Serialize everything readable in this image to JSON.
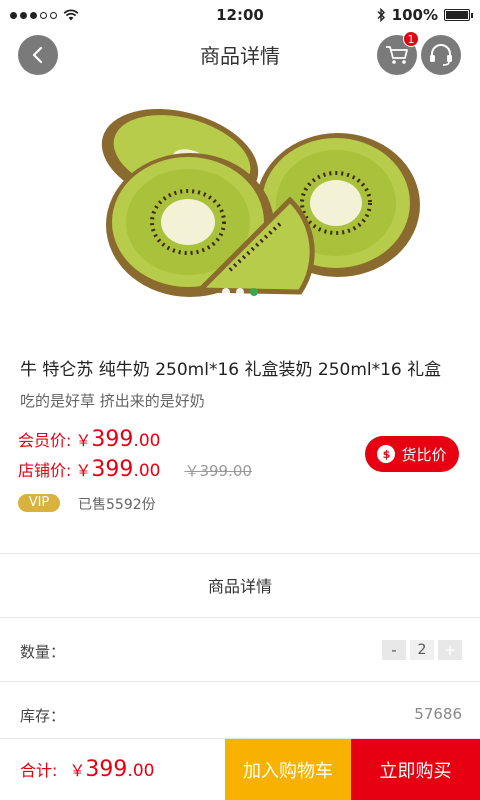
{
  "status_bar": {
    "time": "12:00",
    "battery": "100%"
  },
  "header": {
    "title": "商品详情",
    "cart_count": "1"
  },
  "product": {
    "name": "牛 特仑苏 纯牛奶 250ml*16 礼盒装奶 250ml*16 礼盒",
    "slogan": "吃的是好草 挤出来的是好奶",
    "member_price_label": "会员价:",
    "store_price_label": "店铺价:",
    "currency": "￥",
    "member_price_int": "399",
    "member_price_dec": ".00",
    "store_price_int": "399",
    "store_price_dec": ".00",
    "original_price": "￥399.00",
    "compare_label": "货比价",
    "compare_coin": "$",
    "vip_label": "VIP",
    "sold_text": "已售5592份"
  },
  "carousel": {
    "count": 3,
    "active_index": 2
  },
  "details": {
    "section_title": "商品详情",
    "quantity_label": "数量：",
    "quantity_minus": "-",
    "quantity_value": "2",
    "quantity_plus": "+",
    "stock_label": "库存：",
    "stock_value": "57686"
  },
  "bottom": {
    "total_label": "合计:",
    "total_currency": "￥",
    "total_int": "399",
    "total_dec": ".00",
    "add_to_cart": "加入购物车",
    "buy_now": "立即购买"
  },
  "colors": {
    "accent_red": "#e60012",
    "cart_yellow": "#f9b100",
    "vip_gold": "#d9b23e",
    "carousel_active": "#39a84a"
  }
}
